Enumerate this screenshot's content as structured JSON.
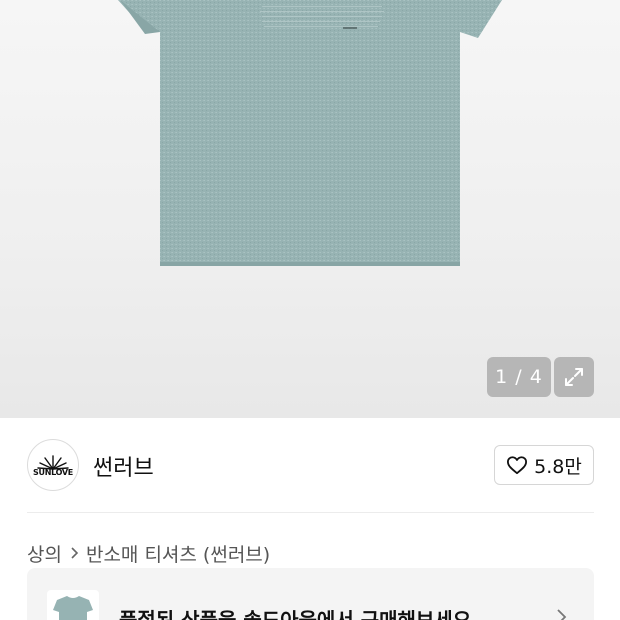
{
  "gallery": {
    "counter": "1 / 4"
  },
  "brand": {
    "logo_text": "SUNLOVE",
    "name": "썬러브",
    "like_count": "5.8만"
  },
  "breadcrumb": {
    "items": [
      "상의",
      "반소매 티셔츠 (썬러브)"
    ]
  },
  "banner": {
    "text": "품절된 상품을 솔드아웃에서 구매해보세요"
  },
  "icons": {
    "expand": "expand-icon",
    "heart": "heart-icon",
    "chevron": "chevron-right-icon"
  },
  "colors": {
    "shirt": "#96b3b3",
    "overlay": "rgba(0,0,0,0.22)"
  }
}
